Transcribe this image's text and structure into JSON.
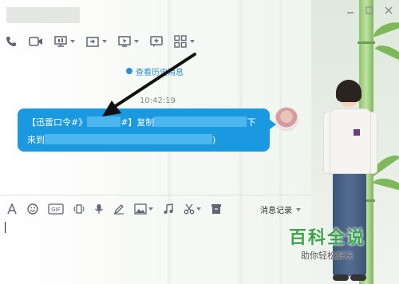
{
  "window": {
    "contact_name": "",
    "controls": [
      "minimize-icon",
      "maximize-icon",
      "close-icon"
    ]
  },
  "toolbar": {
    "items": [
      "phone-icon",
      "video-icon",
      "screen-share-icon",
      "file-transfer-icon",
      "remote-desktop-icon",
      "add-contact-icon",
      "apps-grid-icon"
    ]
  },
  "chat": {
    "history_link": "查看历史消息",
    "timestamp": "10:42:19",
    "message": {
      "line1_start": "【迅雷口令#》",
      "line1_mid": "#】复制",
      "line1_end": "下",
      "line2_start": "来到",
      "line2_end": ")"
    },
    "bubble_color": "#1a98e0"
  },
  "input_toolbar": {
    "items": [
      "font-icon",
      "emoji-icon",
      "gif-icon",
      "shake-icon",
      "voice-icon",
      "draw-icon",
      "image-icon",
      "music-icon",
      "screenshot-icon",
      "history-box-icon"
    ],
    "history_label": "消息记录"
  },
  "watermark": {
    "title": "百科全说",
    "subtitle": "助你轻松解决"
  }
}
